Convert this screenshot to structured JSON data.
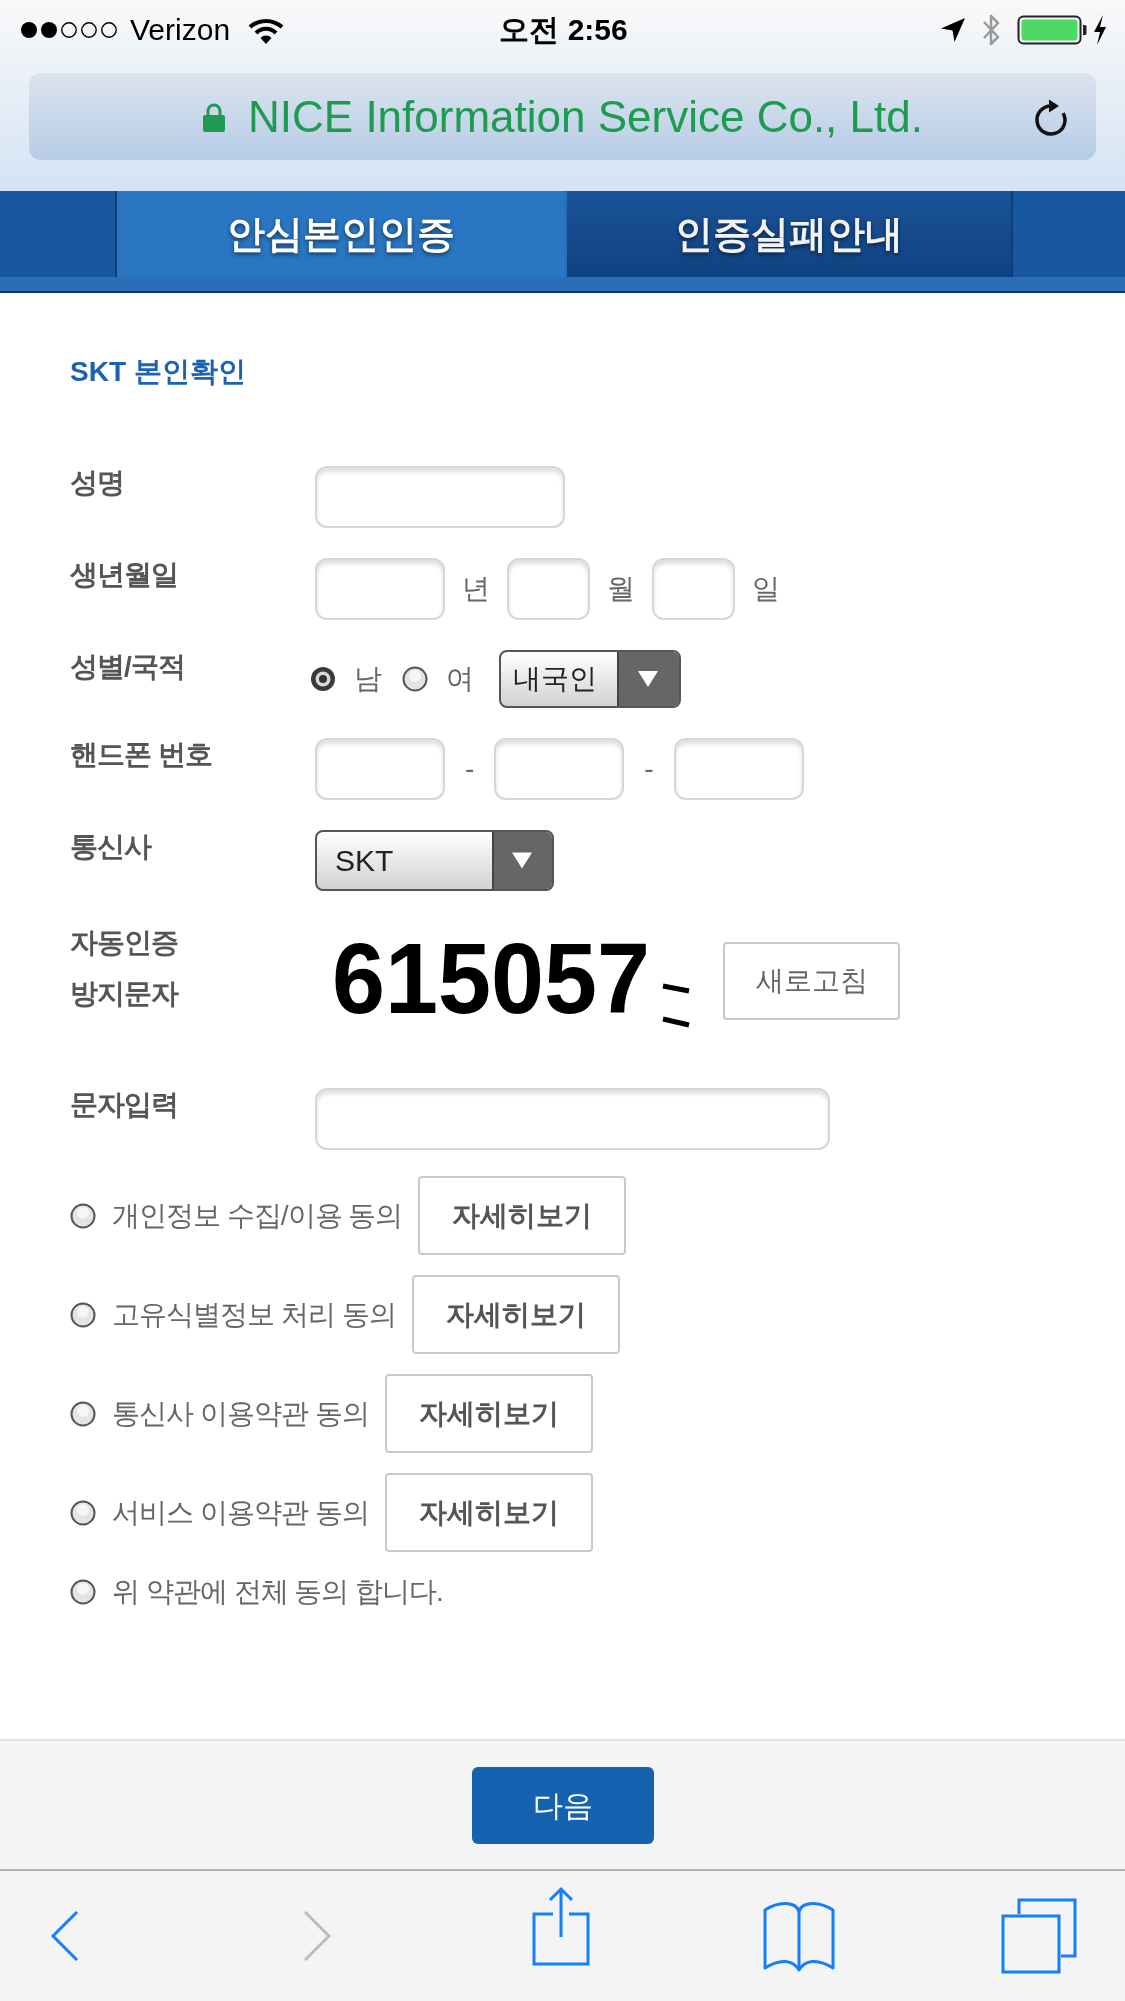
{
  "status_bar": {
    "carrier": "Verizon",
    "time": "오전 2:56"
  },
  "address_bar": {
    "secure": true,
    "site": "NICE Information Service Co., Ltd."
  },
  "tabs": [
    {
      "label": "안심본인인증",
      "selected": true
    },
    {
      "label": "인증실패안내",
      "selected": false
    }
  ],
  "form": {
    "title": "SKT 본인확인",
    "fields": [
      {
        "kind": "text",
        "label": "성명"
      },
      {
        "kind": "date",
        "label": "생년월일",
        "parts": [
          {
            "unit": "년"
          },
          {
            "unit": "월"
          },
          {
            "unit": "일"
          }
        ]
      },
      {
        "kind": "gender",
        "label": "성별/국적",
        "options": [
          {
            "label": "남",
            "selected": true
          },
          {
            "label": "여",
            "selected": false
          }
        ],
        "nationality": "내국인"
      },
      {
        "kind": "phone",
        "label": "핸드폰 번호",
        "separators": [
          "-",
          "-"
        ]
      },
      {
        "kind": "select",
        "label": "통신사",
        "value": "SKT"
      },
      {
        "kind": "captcha",
        "label": "자동인증 방지문자",
        "captcha_text": "615057",
        "refresh_button": "새로고침"
      },
      {
        "kind": "long_text",
        "label": "문자입력"
      }
    ]
  },
  "agreements": [
    {
      "label": "개인정보 수집/이용 동의",
      "checked": false,
      "details_button": "자세히보기"
    },
    {
      "label": "고유식별정보 처리 동의",
      "checked": false,
      "details_button": "자세히보기"
    },
    {
      "label": "통신사 이용약관 동의",
      "checked": false,
      "details_button": "자세히보기"
    },
    {
      "label": "서비스 이용약관 동의",
      "checked": false,
      "details_button": "자세히보기"
    },
    {
      "label": "위 약관에 전체 동의 합니다.",
      "checked": false
    }
  ],
  "next_button": "다음",
  "toolbar": [
    {
      "kind": "back",
      "disabled": false
    },
    {
      "kind": "forward",
      "disabled": true
    },
    {
      "kind": "share",
      "disabled": false
    },
    {
      "kind": "bookmarks",
      "disabled": false
    },
    {
      "kind": "tabs",
      "disabled": false
    }
  ]
}
